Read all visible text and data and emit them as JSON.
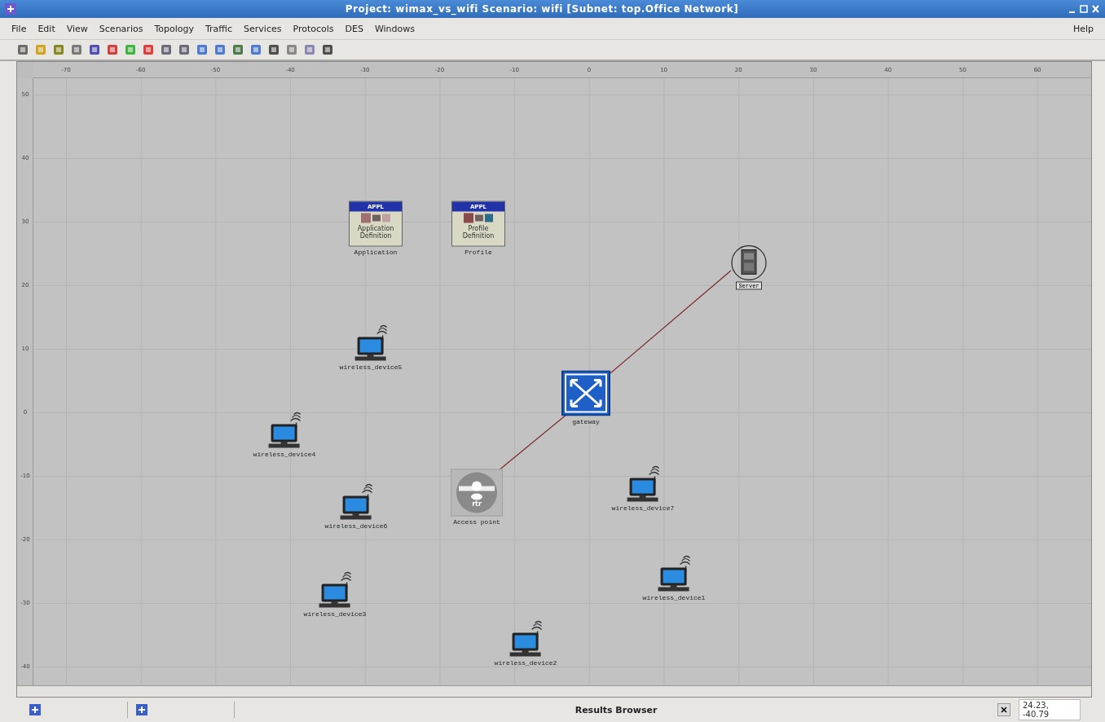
{
  "window": {
    "title": "Project: wimax_vs_wifi Scenario: wifi  [Subnet: top.Office Network]"
  },
  "menu": [
    "File",
    "Edit",
    "View",
    "Scenarios",
    "Topology",
    "Traffic",
    "Services",
    "Protocols",
    "DES",
    "Windows"
  ],
  "help": "Help",
  "ruler": {
    "x_ticks": [
      "-70",
      "-60",
      "-50",
      "-40",
      "-30",
      "-20",
      "-10",
      "0",
      "10",
      "20",
      "30",
      "40",
      "50",
      "60"
    ],
    "y_ticks": [
      "50",
      "40",
      "30",
      "20",
      "10",
      "0",
      "-10",
      "-20",
      "-30",
      "-40"
    ]
  },
  "nodes": [
    {
      "kind": "application",
      "badge": "APPL",
      "caption": "Application Definition",
      "label": "Application"
    },
    {
      "kind": "profile",
      "badge": "APPL",
      "caption": "Profile Definition",
      "label": "Profile"
    },
    {
      "kind": "server",
      "label": "Server"
    },
    {
      "kind": "wireless",
      "label": "wireless_device5"
    },
    {
      "kind": "gateway",
      "label": "gateway"
    },
    {
      "kind": "wireless",
      "label": "wireless_device4"
    },
    {
      "kind": "access_point",
      "badge": "rtr",
      "label": "Access point"
    },
    {
      "kind": "wireless",
      "label": "wireless_device6"
    },
    {
      "kind": "wireless",
      "label": "wireless_device7"
    },
    {
      "kind": "wireless",
      "label": "wireless_device1"
    },
    {
      "kind": "wireless",
      "label": "wireless_device3"
    },
    {
      "kind": "wireless",
      "label": "wireless_device2"
    }
  ],
  "status_bar": {
    "panel": "Results Browser",
    "coordinates": "24.23, -40.79"
  }
}
